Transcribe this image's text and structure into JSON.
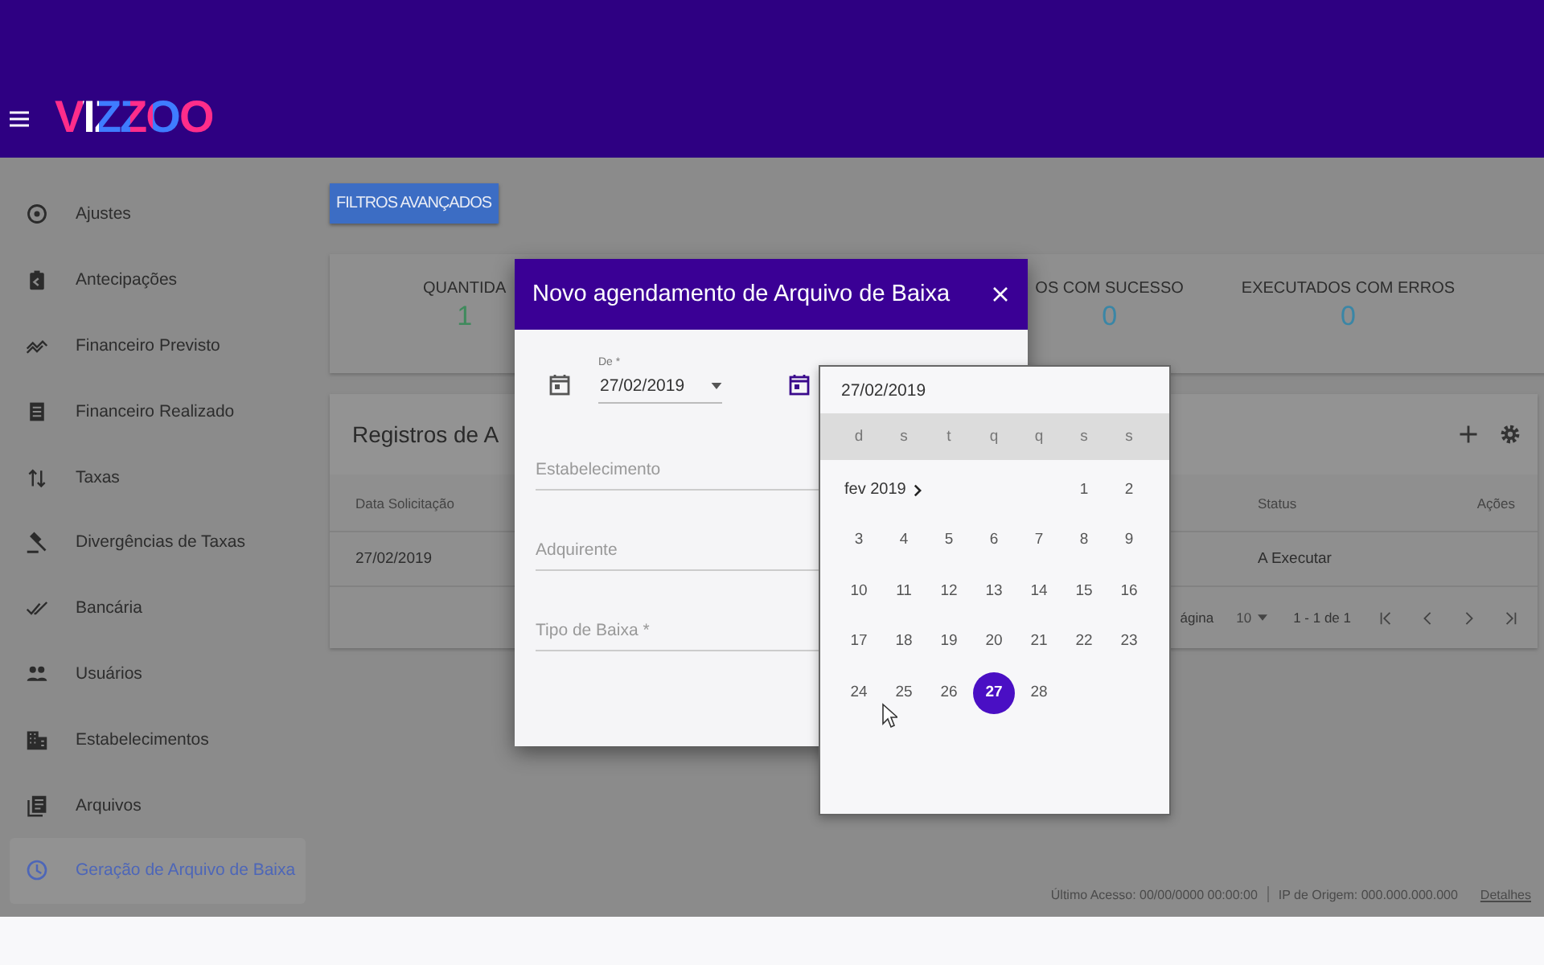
{
  "header": {
    "logo": "VIZZOO"
  },
  "sidebar": {
    "items": [
      {
        "kind": "target",
        "label": "Ajustes",
        "selected": false
      },
      {
        "kind": "clipboard",
        "label": "Antecipações",
        "selected": false
      },
      {
        "kind": "trend",
        "label": "Financeiro Previsto",
        "selected": false
      },
      {
        "kind": "document",
        "label": "Financeiro Realizado",
        "selected": false
      },
      {
        "kind": "updown",
        "label": "Taxas",
        "selected": false
      },
      {
        "kind": "gavel",
        "label": "Divergências de Taxas",
        "selected": false
      },
      {
        "kind": "doublecheck",
        "label": "Bancária",
        "selected": false
      },
      {
        "kind": "people",
        "label": "Usuários",
        "selected": false
      },
      {
        "kind": "building",
        "label": "Estabelecimentos",
        "selected": false
      },
      {
        "kind": "files",
        "label": "Arquivos",
        "selected": false
      },
      {
        "kind": "clock",
        "label": "Geração de Arquivo de Baixa",
        "selected": true
      }
    ]
  },
  "filters_button": "FILTROS AVANÇADOS",
  "stats": [
    {
      "label": "QUANTIDA",
      "value": "1",
      "color": "#3f8a5c"
    },
    {
      "label": "OS COM SUCESSO",
      "value": "0",
      "color": "#3a86a6"
    },
    {
      "label": "EXECUTADOS COM ERROS",
      "value": "0",
      "color": "#3a86a6"
    }
  ],
  "records": {
    "title": "Registros de A",
    "columns": [
      "Data Solicitação",
      "Status",
      "Ações"
    ],
    "rows": [
      {
        "date": "27/02/2019",
        "status": "A Executar"
      }
    ],
    "pagination": {
      "per_page_label": "ágina",
      "per_page": "10",
      "range": "1 - 1 de 1"
    }
  },
  "footer": {
    "last_access": "Último Acesso: 00/00/0000 00:00:00",
    "origin_ip": "IP de Origem: 000.000.000.000",
    "link": "Detalhes"
  },
  "modal": {
    "title": "Novo agendamento de Arquivo de Baixa",
    "date_field": {
      "label": "De *",
      "value": "27/02/2019"
    },
    "fields": [
      {
        "placeholder": "Estabelecimento"
      },
      {
        "placeholder": "Adquirente"
      },
      {
        "placeholder": "Tipo de Baixa *"
      }
    ]
  },
  "datepicker": {
    "value": "27/02/2019",
    "weekdays": [
      "d",
      "s",
      "t",
      "q",
      "q",
      "s",
      "s"
    ],
    "weeks": [
      {
        "month_label": "fev 2019",
        "days": [
          {
            "label": "1",
            "selected": false
          },
          {
            "label": "2",
            "selected": false
          }
        ]
      },
      {
        "days": [
          {
            "label": "3",
            "selected": false
          },
          {
            "label": "4",
            "selected": false
          },
          {
            "label": "5",
            "selected": false
          },
          {
            "label": "6",
            "selected": false
          },
          {
            "label": "7",
            "selected": false
          },
          {
            "label": "8",
            "selected": false
          },
          {
            "label": "9",
            "selected": false
          }
        ]
      },
      {
        "days": [
          {
            "label": "10",
            "selected": false
          },
          {
            "label": "11",
            "selected": false
          },
          {
            "label": "12",
            "selected": false
          },
          {
            "label": "13",
            "selected": false
          },
          {
            "label": "14",
            "selected": false
          },
          {
            "label": "15",
            "selected": false
          },
          {
            "label": "16",
            "selected": false
          }
        ]
      },
      {
        "days": [
          {
            "label": "17",
            "selected": false
          },
          {
            "label": "18",
            "selected": false
          },
          {
            "label": "19",
            "selected": false
          },
          {
            "label": "20",
            "selected": false
          },
          {
            "label": "21",
            "selected": false
          },
          {
            "label": "22",
            "selected": false
          },
          {
            "label": "23",
            "selected": false
          }
        ]
      },
      {
        "days": [
          {
            "label": "24",
            "selected": false
          },
          {
            "label": "25",
            "selected": false
          },
          {
            "label": "26",
            "selected": false
          },
          {
            "label": "27",
            "selected": true
          },
          {
            "label": "28",
            "selected": false
          }
        ]
      }
    ]
  }
}
